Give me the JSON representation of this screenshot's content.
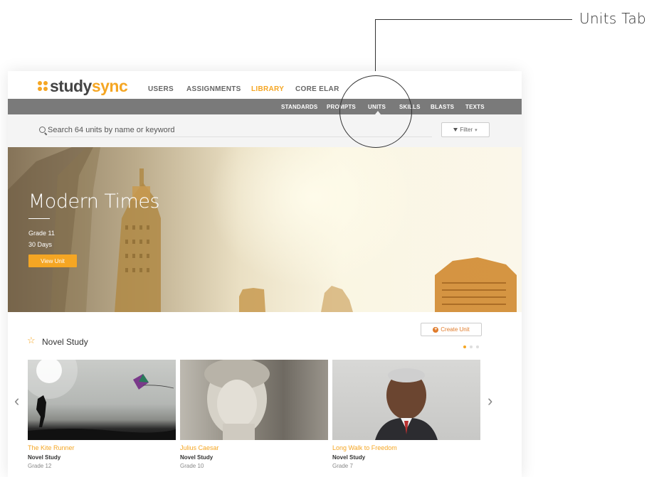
{
  "callout": {
    "label": "Units Tab"
  },
  "logo": {
    "study": "study",
    "sync": "sync"
  },
  "topnav": [
    {
      "label": "USERS"
    },
    {
      "label": "ASSIGNMENTS"
    },
    {
      "label": "LIBRARY"
    },
    {
      "label": "CORE ELAR"
    }
  ],
  "topnav_active": "LIBRARY",
  "subnav": [
    {
      "label": "STANDARDS"
    },
    {
      "label": "PROMPTS"
    },
    {
      "label": "UNITS"
    },
    {
      "label": "SKILLS"
    },
    {
      "label": "BLASTS"
    },
    {
      "label": "TEXTS"
    }
  ],
  "subnav_active": "UNITS",
  "search": {
    "placeholder": "Search 64 units by name or keyword",
    "filter_label": "Filter"
  },
  "hero": {
    "title": "Modern Times",
    "grade": "Grade 11",
    "days": "30 Days",
    "button": "View Unit"
  },
  "section": {
    "title": "Novel Study",
    "create_button": "Create Unit"
  },
  "cards": [
    {
      "title": "The Kite Runner",
      "type": "Novel Study",
      "grade": "Grade 12"
    },
    {
      "title": "Julius Caesar",
      "type": "Novel Study",
      "grade": "Grade 10"
    },
    {
      "title": "Long Walk to Freedom",
      "type": "Novel Study",
      "grade": "Grade 7"
    }
  ],
  "colors": {
    "accent": "#f5a623",
    "subnav_bg": "#7a7a7a",
    "create_accent": "#e07b2a"
  },
  "icons": [
    "search-icon",
    "filter-icon",
    "plus-icon",
    "star-icon",
    "chevron-left-icon",
    "chevron-right-icon"
  ]
}
